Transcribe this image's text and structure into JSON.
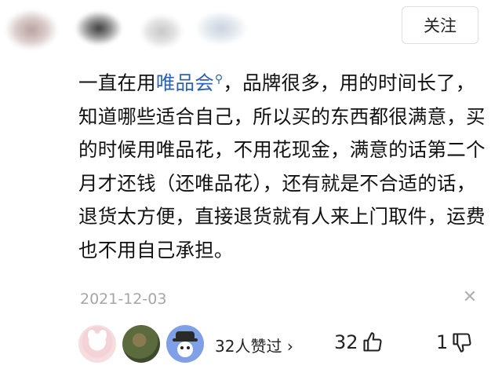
{
  "header": {
    "follow_label": "关注"
  },
  "comment": {
    "before_link": "一直在用",
    "link_text": "唯品会",
    "link_icon": "search-icon",
    "after_link": "，品牌很多，用的时间长了，知道哪些适合自己，所以买的东西都很满意，买的时候用唯品花，不用花现金，满意的话第二个月才还钱（还唯品花），还有就是不合适的话，退货太方便，直接退货就有人来上门取件，运费也不用自己承担。"
  },
  "meta": {
    "date": "2021-12-03",
    "close_icon": "close-icon"
  },
  "reactions": {
    "liked_by": "32人赞过",
    "chevron": "›",
    "up_count": "32",
    "down_count": "1",
    "up_icon": "thumbs-up-icon",
    "down_icon": "thumbs-down-icon"
  },
  "colors": {
    "link": "#2c62b6",
    "date": "#a6a6a6"
  }
}
